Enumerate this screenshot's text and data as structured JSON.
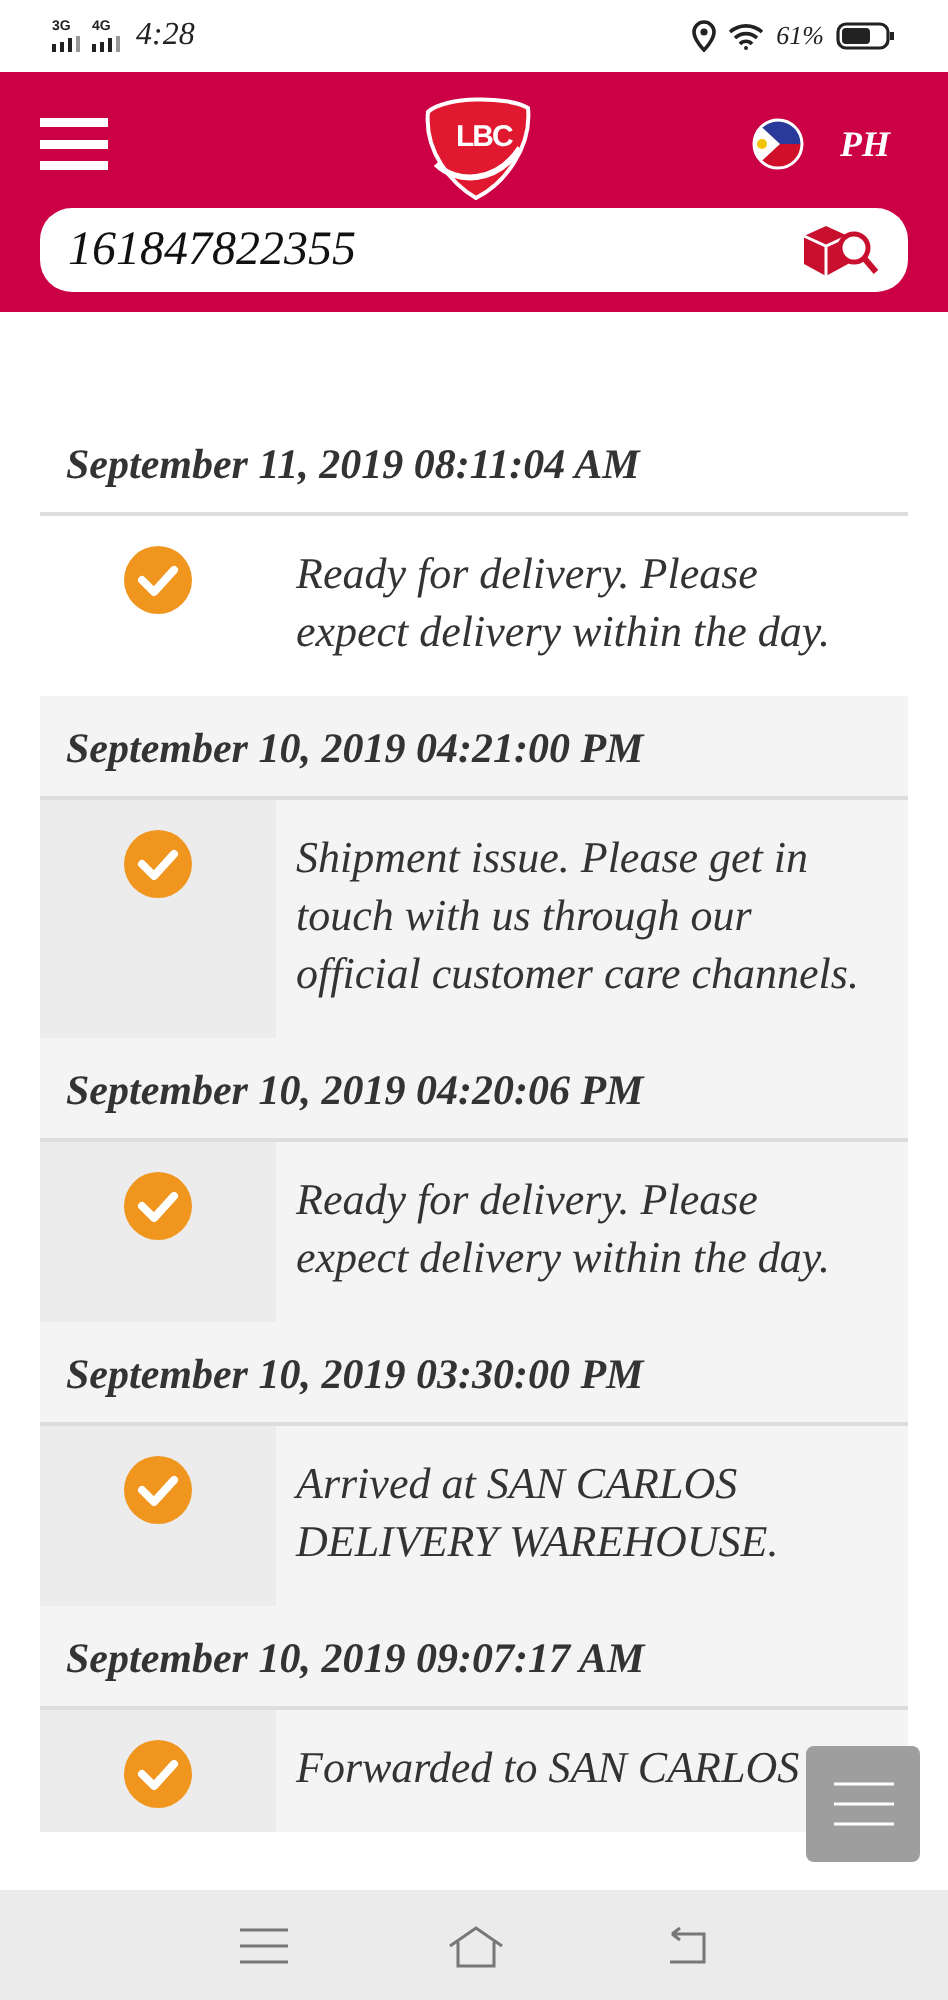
{
  "status_bar": {
    "networks": [
      "3G",
      "4G"
    ],
    "time": "4:28",
    "battery": "61%"
  },
  "header": {
    "logo_text": "LBC",
    "country": "PH"
  },
  "search": {
    "value": "161847822355"
  },
  "events": [
    {
      "date": "September 11, 2019 08:11:04 AM",
      "status": "Ready for delivery. Please expect delivery within the day.",
      "shaded": false
    },
    {
      "date": "September 10, 2019 04:21:00 PM",
      "status": "Shipment issue. Please get in touch with us through our official customer care channels.",
      "shaded": true
    },
    {
      "date": "September 10, 2019 04:20:06 PM",
      "status": "Ready for delivery. Please expect delivery within the day.",
      "shaded": true
    },
    {
      "date": "September 10, 2019 03:30:00 PM",
      "status": "Arrived at SAN CARLOS DELIVERY WAREHOUSE.",
      "shaded": true
    },
    {
      "date": "September 10, 2019 09:07:17 AM",
      "status": "Forwarded to SAN CARLOS",
      "shaded": true
    }
  ]
}
